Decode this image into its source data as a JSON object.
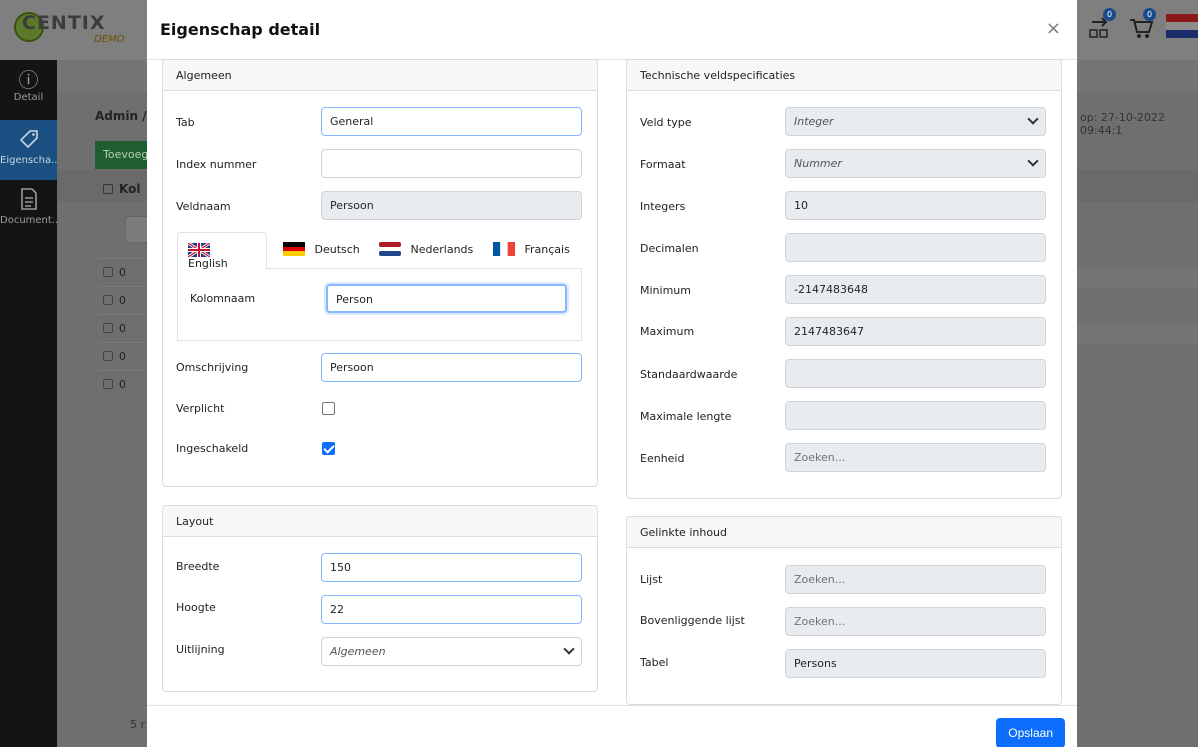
{
  "app": {
    "brand": "CENTIX",
    "brand_sub": "DEMO",
    "badge_1": "0",
    "badge_2": "0"
  },
  "sidebar": {
    "items": [
      {
        "label": "Detail"
      },
      {
        "label": "Eigenscha..."
      },
      {
        "label": "Document..."
      }
    ]
  },
  "background": {
    "breadcrumb": "Admin /",
    "add_button": "Toevoeg",
    "column_header": "Kol",
    "row_value": "0",
    "footer_text": "5 r",
    "timestamp": "op: 27-10-2022 09:44:1"
  },
  "modal": {
    "title": "Eigenschap detail",
    "close": "×",
    "save_label": "Opslaan"
  },
  "algemeen": {
    "header": "Algemeen",
    "tab_label": "Tab",
    "tab_value": "General",
    "index_label": "Index nummer",
    "index_value": "",
    "veldnaam_label": "Veldnaam",
    "veldnaam_value": "Persoon",
    "languages": [
      {
        "label": "English"
      },
      {
        "label": "Deutsch"
      },
      {
        "label": "Nederlands"
      },
      {
        "label": "Français"
      }
    ],
    "kolomnaam_label": "Kolomnaam",
    "kolomnaam_value": "Person",
    "omschrijving_label": "Omschrijving",
    "omschrijving_value": "Persoon",
    "verplicht_label": "Verplicht",
    "verplicht_checked": false,
    "ingeschakeld_label": "Ingeschakeld",
    "ingeschakeld_checked": true
  },
  "layout": {
    "header": "Layout",
    "breedte_label": "Breedte",
    "breedte_value": "150",
    "hoogte_label": "Hoogte",
    "hoogte_value": "22",
    "uitlijning_label": "Uitlijning",
    "uitlijning_value": "Algemeen"
  },
  "technisch": {
    "header": "Technische veldspecificaties",
    "veldtype_label": "Veld type",
    "veldtype_value": "Integer",
    "formaat_label": "Formaat",
    "formaat_value": "Nummer",
    "integers_label": "Integers",
    "integers_value": "10",
    "decimalen_label": "Decimalen",
    "decimalen_value": "",
    "minimum_label": "Minimum",
    "minimum_value": "-2147483648",
    "maximum_label": "Maximum",
    "maximum_value": "2147483647",
    "standaard_label": "Standaardwaarde",
    "standaard_value": "",
    "maxlengte_label": "Maximale lengte",
    "maxlengte_value": "",
    "eenheid_label": "Eenheid",
    "eenheid_placeholder": "Zoeken..."
  },
  "gelinkt": {
    "header": "Gelinkte inhoud",
    "lijst_label": "Lijst",
    "lijst_placeholder": "Zoeken...",
    "bovenliggend_label": "Bovenliggende lijst",
    "bovenliggend_placeholder": "Zoeken...",
    "tabel_label": "Tabel",
    "tabel_value": "Persons"
  }
}
